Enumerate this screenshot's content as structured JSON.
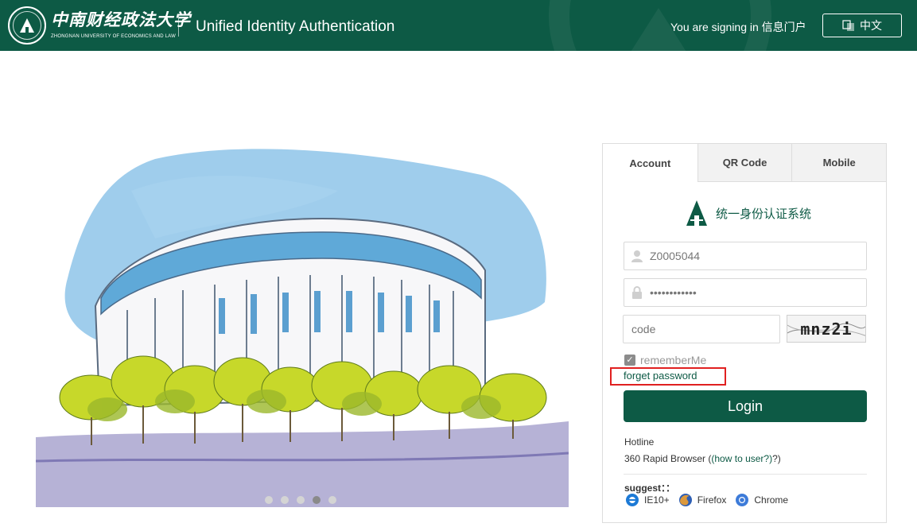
{
  "header": {
    "logo_cn": "中南财经政法大学",
    "logo_en": "ZHONGNAN UNIVERSITY OF ECONOMICS AND LAW",
    "title": "Unified Identity Authentication",
    "signing_in": "You are signing in 信息门户",
    "language_button": "中文",
    "color": "#0d5a45"
  },
  "tabs": [
    {
      "label": "Account",
      "active": true
    },
    {
      "label": "QR Code",
      "active": false
    },
    {
      "label": "Mobile",
      "active": false
    }
  ],
  "login": {
    "system_title": "统一身份认证系统",
    "username_value": "Z0005044",
    "password_value": "••••••••••••",
    "code_placeholder": "code",
    "captcha_text": "mnz2i",
    "remember_label": "rememberMe",
    "remember_checked": true,
    "forget_label": "forget password",
    "login_button": "Login"
  },
  "info": {
    "hotline": "Hotline",
    "browser_text": "360 Rapid Browser (",
    "browser_link": "(how to user?)",
    "browser_after": "?)",
    "suggest": "suggest：：",
    "browsers": [
      {
        "name": "IE10+",
        "icon": "ie-icon"
      },
      {
        "name": "Firefox",
        "icon": "firefox-icon"
      },
      {
        "name": "Chrome",
        "icon": "chrome-icon"
      }
    ]
  },
  "carousel": {
    "count": 5,
    "active_index": 3
  }
}
